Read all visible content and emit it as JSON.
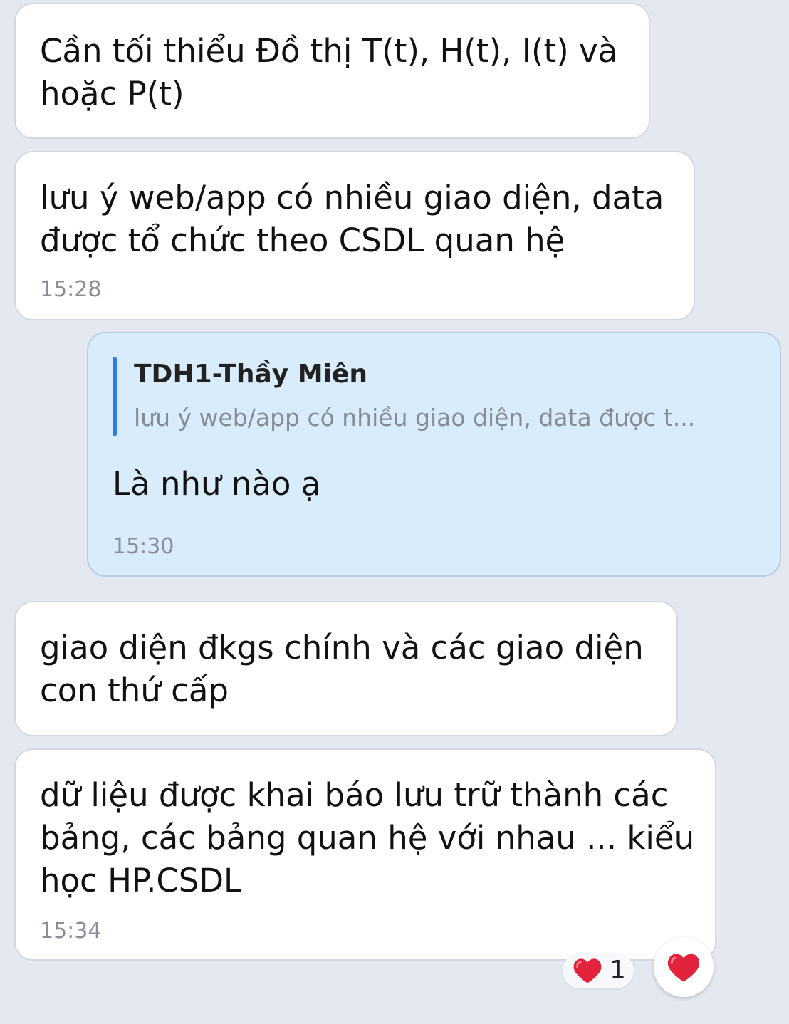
{
  "messages": [
    {
      "direction": "incoming",
      "text": "Cần tối thiểu Đồ thị T(t), H(t), I(t) và\nhoặc P(t)",
      "time": ""
    },
    {
      "direction": "incoming",
      "text": "lưu ý web/app có nhiều giao diện, data\nđược tổ chức theo CSDL quan hệ",
      "time": "15:28"
    },
    {
      "direction": "outgoing",
      "quote": {
        "author": "TDH1-Thầy Miên",
        "snippet": "lưu ý web/app có nhiều giao diện, data được t..."
      },
      "text": "Là như nào ạ",
      "time": "15:30"
    },
    {
      "direction": "incoming",
      "text": "giao diện đkgs chính và các giao diện\ncon thứ cấp",
      "time": ""
    },
    {
      "direction": "incoming",
      "text": "dữ liệu được khai báo lưu trữ thành các\nbảng, các bảng quan hệ với nhau ... kiểu\nhọc HP.CSDL",
      "time": "15:34"
    }
  ],
  "reaction": {
    "icon": "heart-icon",
    "count": "1",
    "color": "#e3223b"
  },
  "colors": {
    "background": "#e4e8f0",
    "incoming_bubble": "#ffffff",
    "outgoing_bubble": "#d9ecfc",
    "quote_bar": "#2f7ee6",
    "timestamp": "#8a8f97"
  }
}
